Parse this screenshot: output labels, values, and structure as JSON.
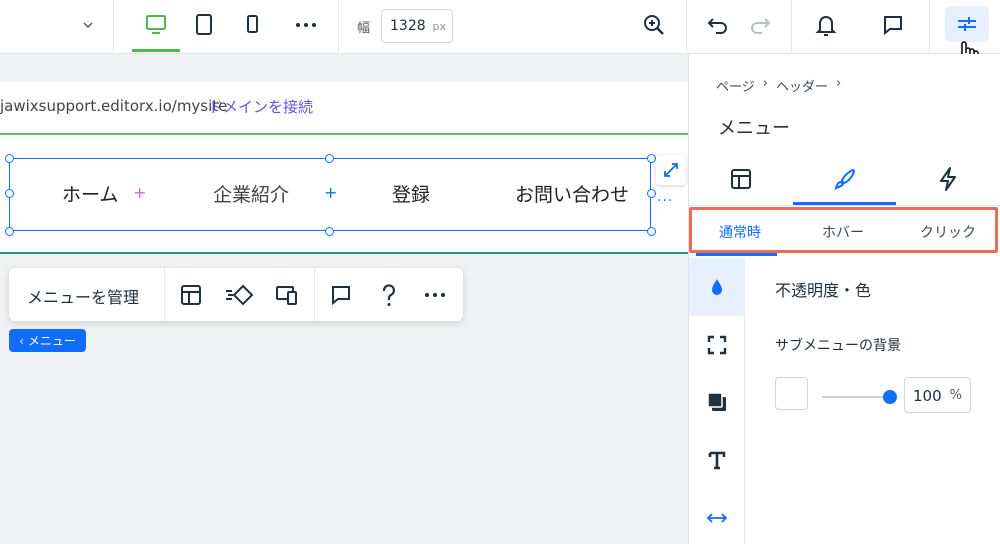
{
  "topbar": {
    "width_label": "幅",
    "width_value": "1328",
    "width_unit": "px",
    "icons": [
      "chevron-down-icon",
      "desktop-icon",
      "tablet-icon",
      "mobile-icon",
      "more-icon",
      "zoom-icon",
      "undo-icon",
      "redo-icon",
      "bell-icon",
      "comment-icon",
      "settings-sliders-icon"
    ]
  },
  "canvas": {
    "url": "jawixsupport.editorx.io/mysite",
    "connect_domain": "ドメインを接続",
    "menu_items": [
      "ホーム",
      "企業紹介",
      "登録",
      "お問い合わせ"
    ]
  },
  "context_toolbar": {
    "manage_label": "メニューを管理",
    "icons": [
      "layout-icon",
      "animation-icon",
      "responsive-icon",
      "comment-icon",
      "help-icon",
      "more-icon"
    ]
  },
  "tag_badge": {
    "label": "メニュー"
  },
  "panel": {
    "breadcrumb": [
      "ページ",
      "ヘッダー"
    ],
    "title": "メニュー",
    "tabs": [
      "layout-icon",
      "design-brush-icon",
      "interactions-bolt-icon"
    ],
    "states": [
      "通常時",
      "ホバー",
      "クリック"
    ],
    "section_title": "不透明度・色",
    "field_label": "サブメニューの背景",
    "opacity_value": "100",
    "opacity_unit": "%",
    "opacity_fraction": 1.0,
    "rail_icons": [
      "fill-drop-icon",
      "border-corners-icon",
      "shadow-icon",
      "text-icon",
      "spacing-arrows-icon"
    ]
  },
  "colors": {
    "accent": "#116dff",
    "highlight_border": "#ef6c53",
    "link_purple": "#6b4ee6",
    "device_active": "#4eb84e"
  }
}
